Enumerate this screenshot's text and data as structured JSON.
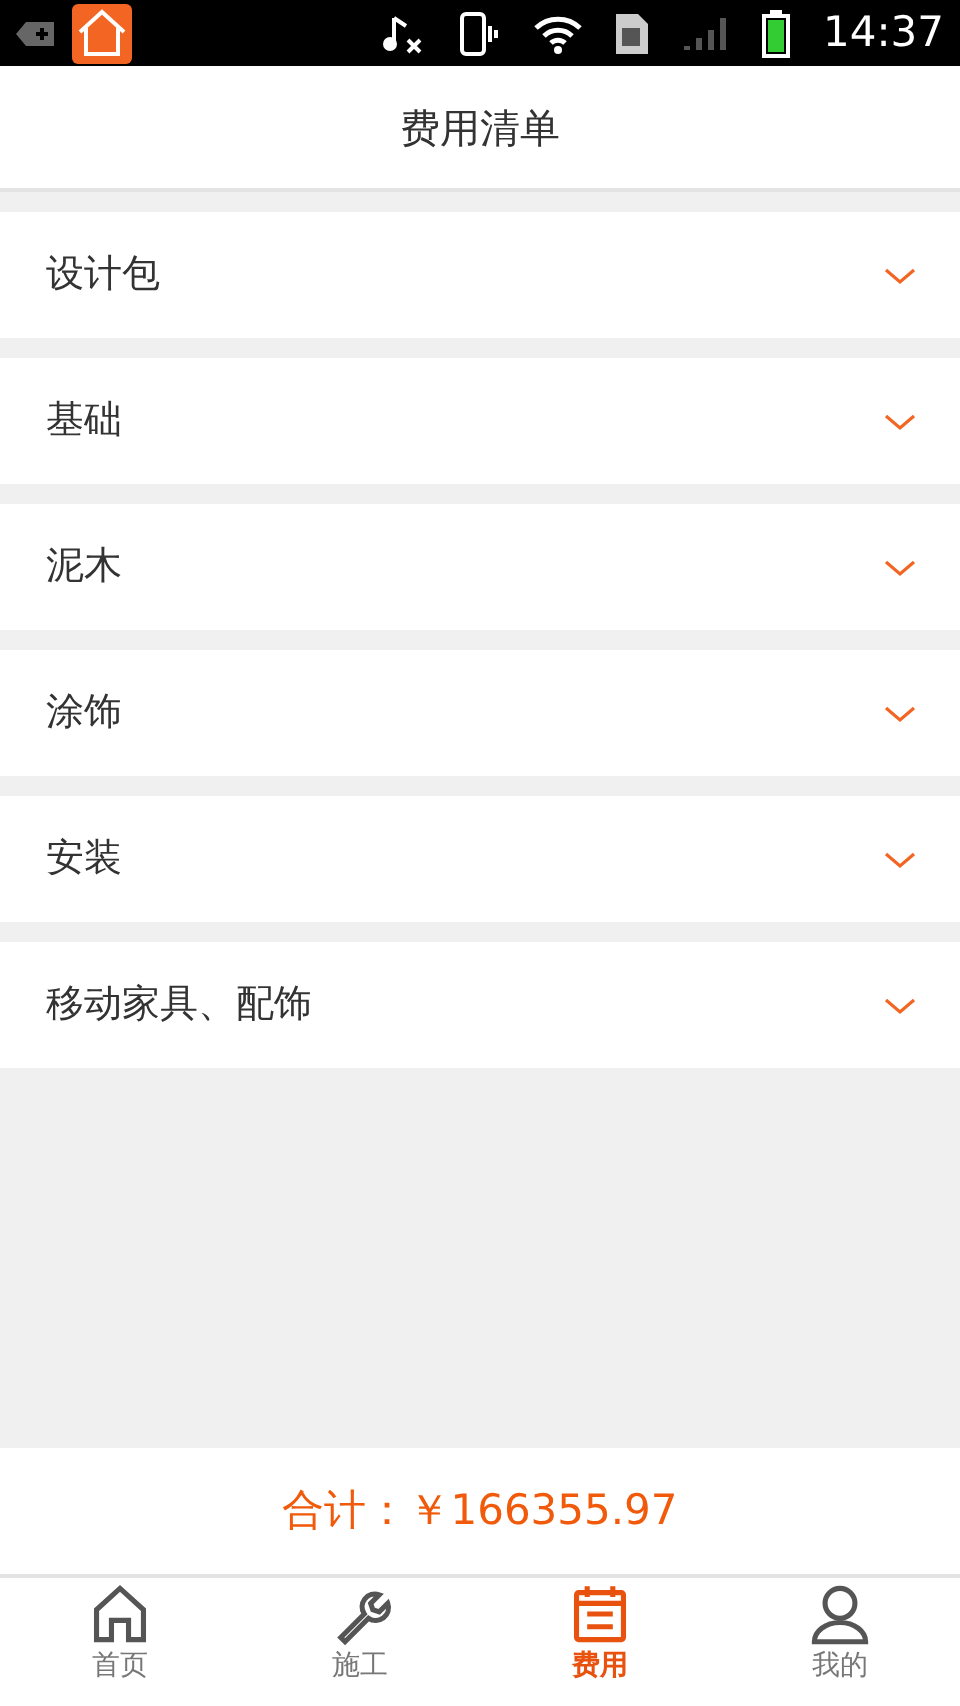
{
  "status_bar": {
    "time": "14:37"
  },
  "header": {
    "title": "费用清单"
  },
  "sections": [
    {
      "label": "设计包",
      "expanded": false
    },
    {
      "label": "基础",
      "expanded": false
    },
    {
      "label": "泥木",
      "expanded": false
    },
    {
      "label": "涂饰",
      "expanded": false
    },
    {
      "label": "安装",
      "expanded": false
    },
    {
      "label": "移动家具、配饰",
      "expanded": false
    }
  ],
  "total": {
    "text": "合计：￥166355.97"
  },
  "tabs": [
    {
      "kind": "home",
      "label": "首页",
      "selected": false
    },
    {
      "kind": "tool",
      "label": "施工",
      "selected": false
    },
    {
      "kind": "bill",
      "label": "费用",
      "selected": true
    },
    {
      "kind": "user",
      "label": "我的",
      "selected": false
    }
  ]
}
